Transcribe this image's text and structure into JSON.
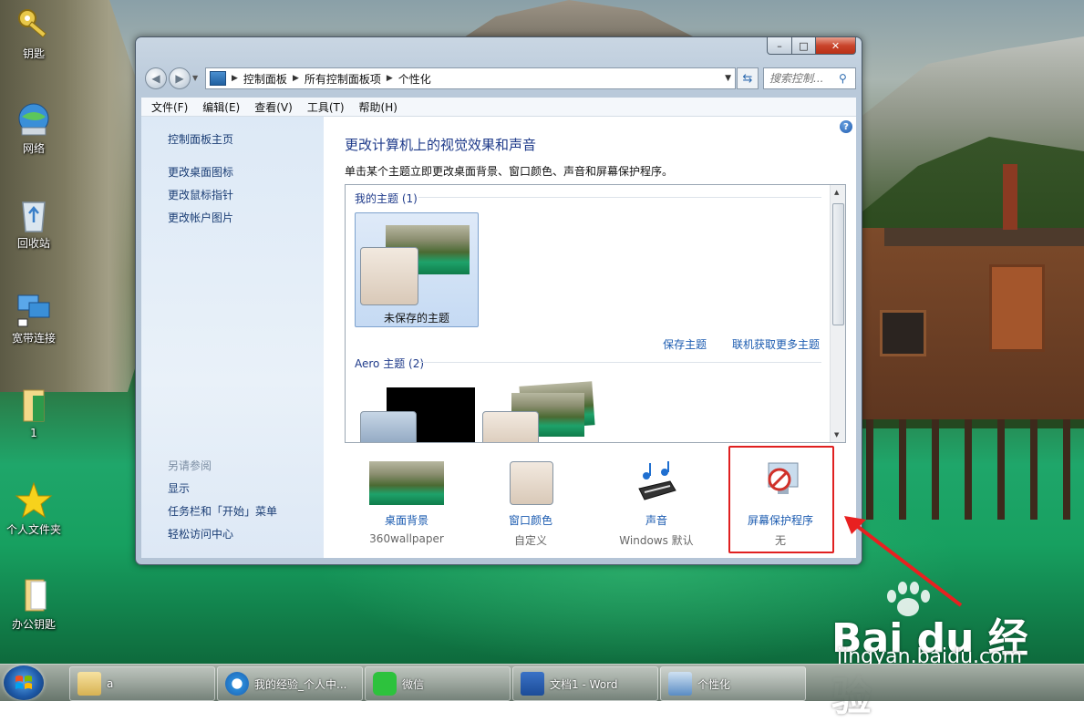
{
  "desktop": {
    "icons": [
      {
        "label": "钥匙",
        "icon": "key-icon"
      },
      {
        "label": "网络",
        "icon": "network-icon"
      },
      {
        "label": "回收站",
        "icon": "recycle-bin-icon"
      },
      {
        "label": "宽带连接",
        "icon": "broadband-icon"
      },
      {
        "label": "1",
        "icon": "folder-icon"
      },
      {
        "label": "个人文件夹",
        "icon": "star-icon"
      },
      {
        "label": "办公钥匙",
        "icon": "folder-icon"
      }
    ]
  },
  "window": {
    "caption": {
      "min": "–",
      "max": "□",
      "close": "✕"
    },
    "address": {
      "crumbs": [
        "控制面板",
        "所有控制面板项",
        "个性化"
      ]
    },
    "search_placeholder": "搜索控制...",
    "menu": [
      "文件(F)",
      "编辑(E)",
      "查看(V)",
      "工具(T)",
      "帮助(H)"
    ],
    "sidebar": {
      "home": "控制面板主页",
      "links": [
        "更改桌面图标",
        "更改鼠标指针",
        "更改帐户图片"
      ],
      "see_also_title": "另请参阅",
      "see_also": [
        "显示",
        "任务栏和「开始」菜单",
        "轻松访问中心"
      ]
    },
    "main": {
      "title": "更改计算机上的视觉效果和声音",
      "description": "单击某个主题立即更改桌面背景、窗口颜色、声音和屏幕保护程序。",
      "my_themes_header": "我的主题 (1)",
      "unsaved_theme": "未保存的主题",
      "save_theme": "保存主题",
      "get_more": "联机获取更多主题",
      "aero_header": "Aero 主题 (2)"
    },
    "bottom": [
      {
        "label": "桌面背景",
        "value": "360wallpaper",
        "icon": "wallpaper-icon"
      },
      {
        "label": "窗口颜色",
        "value": "自定义",
        "icon": "window-color-icon"
      },
      {
        "label": "声音",
        "value": "Windows 默认",
        "icon": "sound-icon"
      },
      {
        "label": "屏幕保护程序",
        "value": "无",
        "icon": "screensaver-icon"
      }
    ]
  },
  "watermark": {
    "brand": "Bai du 经验",
    "url": "jingyan.baidu.com"
  },
  "taskbar": {
    "items": [
      {
        "label": "a",
        "icon": "folder-icon"
      },
      {
        "label": "我的经验_个人中...",
        "icon": "browser-icon"
      },
      {
        "label": "微信",
        "icon": "wechat-icon"
      },
      {
        "label": "文档1 - Word",
        "icon": "word-icon"
      },
      {
        "label": "个性化",
        "icon": "personalize-icon"
      }
    ]
  },
  "colors": {
    "link": "#1b5bb0",
    "title": "#1e3a8a",
    "highlight_box": "#e02020"
  }
}
